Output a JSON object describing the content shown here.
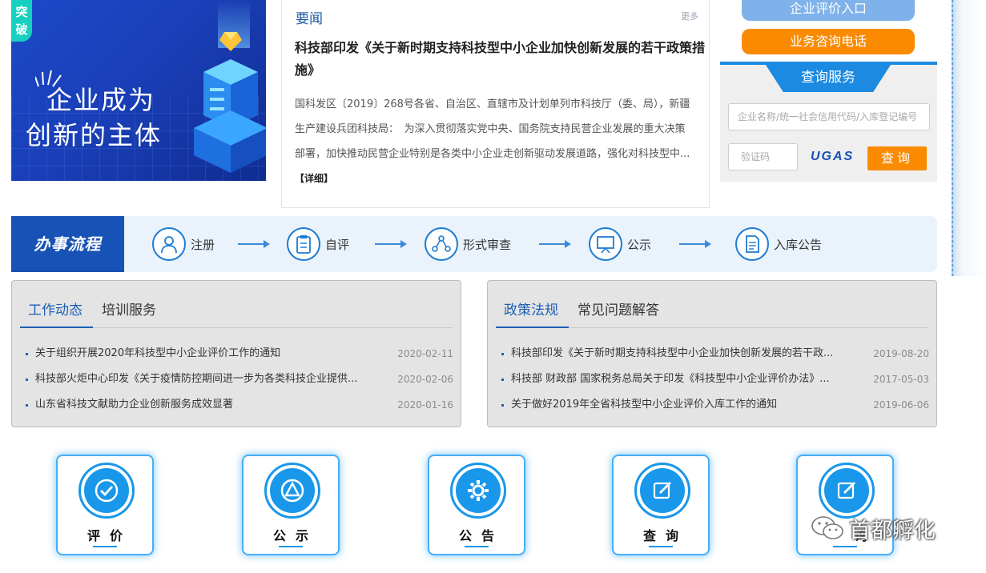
{
  "banner": {
    "tag": "突破",
    "line1": "企业成为",
    "line2": "创新的主体"
  },
  "news": {
    "heading": "要闻",
    "more": "更多",
    "title": "科技部印发《关于新时期支持科技型中小企业加快创新发展的若干政策措施》",
    "summary": "国科发区〔2019〕268号各省、自治区、直辖市及计划单列市科技厅（委、局），新疆生产建设兵团科技局：　为深入贯彻落实党中央、国务院支持民营企业发展的重大决策部署，加快推动民营企业特别是各类中小企业走创新驱动发展道路，强化对科技型中...",
    "detail": "【详细】"
  },
  "sidebar": {
    "eval_entry": "企业评价入口",
    "phone": "业务咨询电话",
    "query_title": "查询服务",
    "query_placeholder": "企业名称/统一社会信用代码/入库登记编号",
    "code_placeholder": "验证码",
    "captcha": "UGAS",
    "query_button": "查询"
  },
  "process": {
    "title": "办事流程",
    "steps": [
      {
        "label": "注册",
        "icon": "user-icon"
      },
      {
        "label": "自评",
        "icon": "clipboard-icon"
      },
      {
        "label": "形式审查",
        "icon": "network-icon"
      },
      {
        "label": "公示",
        "icon": "presentation-icon"
      },
      {
        "label": "入库公告",
        "icon": "document-icon"
      }
    ]
  },
  "left_panel": {
    "tabs": [
      "工作动态",
      "培训服务"
    ],
    "items": [
      {
        "title": "关于组织开展2020年科技型中小企业评价工作的通知",
        "date": "2020-02-11"
      },
      {
        "title": "科技部火炬中心印发《关于疫情防控期间进一步为各类科技企业提供...",
        "date": "2020-02-06"
      },
      {
        "title": "山东省科技文献助力企业创新服务成效显著",
        "date": "2020-01-16"
      }
    ]
  },
  "right_panel": {
    "tabs": [
      "政策法规",
      "常见问题解答"
    ],
    "items": [
      {
        "title": "科技部印发《关于新时期支持科技型中小企业加快创新发展的若干政...",
        "date": "2019-08-20"
      },
      {
        "title": "科技部 财政部 国家税务总局关于印发《科技型中小企业评价办法》...",
        "date": "2017-05-03"
      },
      {
        "title": "关于做好2019年全省科技型中小企业评价入库工作的通知",
        "date": "2019-06-06"
      }
    ]
  },
  "services": [
    {
      "label": "评价",
      "icon": "check-icon"
    },
    {
      "label": "公示",
      "icon": "announce-icon"
    },
    {
      "label": "公告",
      "icon": "gear-icon"
    },
    {
      "label": "查询",
      "icon": "edit-icon"
    },
    {
      "label": "询",
      "icon": "edit-icon"
    }
  ],
  "watermark": {
    "text": "首都孵化"
  },
  "colors": {
    "primary_blue": "#1752b6",
    "accent_blue": "#1997ea",
    "orange": "#fa8a00",
    "light_blue": "#7fb2ea"
  }
}
